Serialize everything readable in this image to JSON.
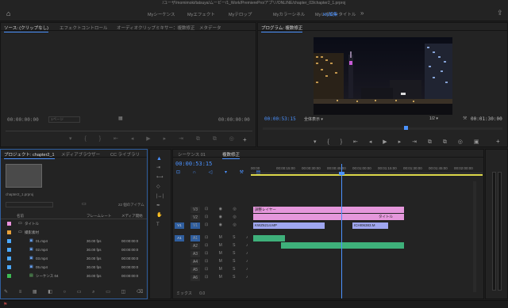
{
  "window": {
    "title": "/ユーザ/momimoki/tatsuya/ムービー/1_Work/PremierePro/アプリ/ONLINE/chapter_03/chapter2_1.prproj"
  },
  "workspaces": [
    {
      "label": "Myシーケンス",
      "active": false
    },
    {
      "label": "Myエフェクト",
      "active": false
    },
    {
      "label": "Myテロップ",
      "active": false
    },
    {
      "label": "Myカラーシネル",
      "active": false
    },
    {
      "label": "Myレガシータイトル",
      "active": false
    },
    {
      "label": "My編集",
      "active": true
    }
  ],
  "source_panel": {
    "tabs": [
      "ソース: (クリップなし)",
      "エフェクトコントロール",
      "オーディオクリップミキサー：複数修正",
      "メタデータ"
    ],
    "timecode_left": "00:00:00:00",
    "page_label": "1ページ",
    "timecode_right": "00:00:00:00"
  },
  "program_panel": {
    "title": "プログラム: 複数修正",
    "timecode": "00:00:53:15",
    "fit": "全体表示",
    "quality": "1/2",
    "duration": "00:01:30:00",
    "playhead_pct": 59
  },
  "project_panel": {
    "tabs": [
      "プロジェクト: chapter2_1",
      "メディアブラウザー",
      "CC ライブラリ"
    ],
    "file": "chapter2_1.prproj",
    "count": "22 個のアイテム",
    "columns": [
      "名前",
      "フレームレート",
      "メディア開始"
    ],
    "items": [
      {
        "name": "タイトル",
        "fps": "",
        "start": "",
        "color": "#e991dd",
        "kind": "bin"
      },
      {
        "name": "撮影素材",
        "fps": "",
        "start": "",
        "color": "#e9a23b",
        "kind": "bin"
      },
      {
        "name": "01.mp4",
        "fps": "30.00 fps",
        "start": "00:00:00:0",
        "color": "#4aa8ff",
        "kind": "clip"
      },
      {
        "name": "02.mp4",
        "fps": "30.00 fps",
        "start": "00:00:00:0",
        "color": "#4aa8ff",
        "kind": "clip"
      },
      {
        "name": "03.mp4",
        "fps": "30.00 fps",
        "start": "00:00:00:0",
        "color": "#4aa8ff",
        "kind": "clip"
      },
      {
        "name": "05.mp4",
        "fps": "30.00 fps",
        "start": "00:00:00:0",
        "color": "#4aa8ff",
        "kind": "clip"
      },
      {
        "name": "シーケンス 04",
        "fps": "30.00 fps",
        "start": "00:00:00:0",
        "color": "#3dbb52",
        "kind": "seq"
      }
    ]
  },
  "timeline": {
    "tabs": [
      "シーケンス 01",
      "複数修正"
    ],
    "timecode": "00:00:53:15",
    "ruler": [
      "00:00",
      "00:00:15:00",
      "00:00:30:00",
      "00:00:45:00",
      "00:01:00:00",
      "00:01:15:00",
      "00:01:30:00",
      "00:01:45:00",
      "00:02:00:00"
    ],
    "video_tracks": [
      "V3",
      "V2",
      "V1"
    ],
    "audio_tracks": [
      "A1",
      "A2",
      "A3",
      "A4",
      "A5",
      "A6"
    ],
    "source_patch": [
      "V1",
      "A1"
    ],
    "mix_label": "ミックス",
    "mix_value": "0.0",
    "clips": {
      "adjustment": "調整レイヤー",
      "title": "タイトル",
      "video1": "KWZ6214.MP",
      "video2": "ICHI06383.M"
    }
  },
  "colors": {
    "accent": "#4b92ff",
    "adjustment_clip": "#e597dc",
    "video_clip": "#9fa6ef",
    "title_clip": "#e597dc",
    "audio_clip": "#3eb07a"
  }
}
